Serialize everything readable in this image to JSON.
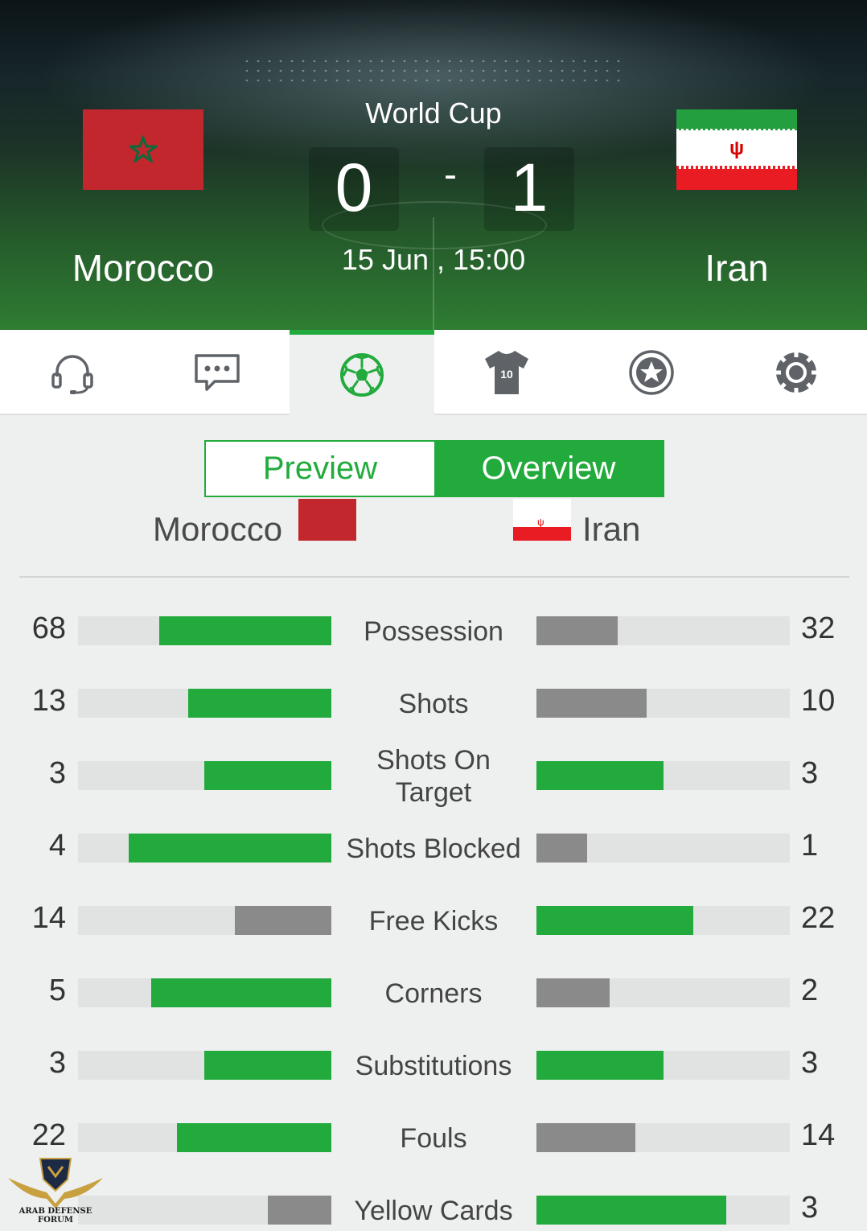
{
  "match": {
    "competition": "World Cup",
    "home_team": "Morocco",
    "away_team": "Iran",
    "home_score": "0",
    "away_score": "1",
    "separator": "-",
    "datetime": "15 Jun , 15:00"
  },
  "nav": {
    "items": [
      {
        "name": "commentary",
        "icon": "headset-icon"
      },
      {
        "name": "chat",
        "icon": "chat-bubble-icon"
      },
      {
        "name": "match-stats",
        "icon": "soccer-ball-icon",
        "active": true
      },
      {
        "name": "lineups",
        "icon": "jersey-icon",
        "number": "10"
      },
      {
        "name": "highlights",
        "icon": "star-badge-icon"
      },
      {
        "name": "settings",
        "icon": "gear-icon"
      }
    ]
  },
  "segmented": {
    "preview_label": "Preview",
    "overview_label": "Overview",
    "selected": "Overview"
  },
  "colors": {
    "accent_green": "#22ab3c",
    "bar_grey": "#8a8a8a",
    "track": "#e1e3e2"
  },
  "stats": [
    {
      "label": "Possession",
      "home": "68",
      "away": "32",
      "home_fraction": 0.68,
      "away_fraction": 0.32,
      "home_color": "green",
      "away_color": "grey"
    },
    {
      "label": "Shots",
      "home": "13",
      "away": "10",
      "home_fraction": 0.565,
      "away_fraction": 0.435,
      "home_color": "green",
      "away_color": "grey"
    },
    {
      "label": "Shots On Target",
      "home": "3",
      "away": "3",
      "home_fraction": 0.5,
      "away_fraction": 0.5,
      "home_color": "green",
      "away_color": "green"
    },
    {
      "label": "Shots Blocked",
      "home": "4",
      "away": "1",
      "home_fraction": 0.8,
      "away_fraction": 0.2,
      "home_color": "green",
      "away_color": "grey"
    },
    {
      "label": "Free Kicks",
      "home": "14",
      "away": "22",
      "home_fraction": 0.38,
      "away_fraction": 0.62,
      "home_color": "grey",
      "away_color": "green"
    },
    {
      "label": "Corners",
      "home": "5",
      "away": "2",
      "home_fraction": 0.71,
      "away_fraction": 0.29,
      "home_color": "green",
      "away_color": "grey"
    },
    {
      "label": "Substitutions",
      "home": "3",
      "away": "3",
      "home_fraction": 0.5,
      "away_fraction": 0.5,
      "home_color": "green",
      "away_color": "green"
    },
    {
      "label": "Fouls",
      "home": "22",
      "away": "14",
      "home_fraction": 0.61,
      "away_fraction": 0.39,
      "home_color": "green",
      "away_color": "grey"
    },
    {
      "label": "Yellow Cards",
      "home": "",
      "away": "3",
      "home_fraction": 0.25,
      "away_fraction": 0.75,
      "home_color": "grey",
      "away_color": "green"
    }
  ],
  "watermark": {
    "text": "ARAB DEFENSE FORUM",
    "icon": "eagle-shield-logo"
  }
}
